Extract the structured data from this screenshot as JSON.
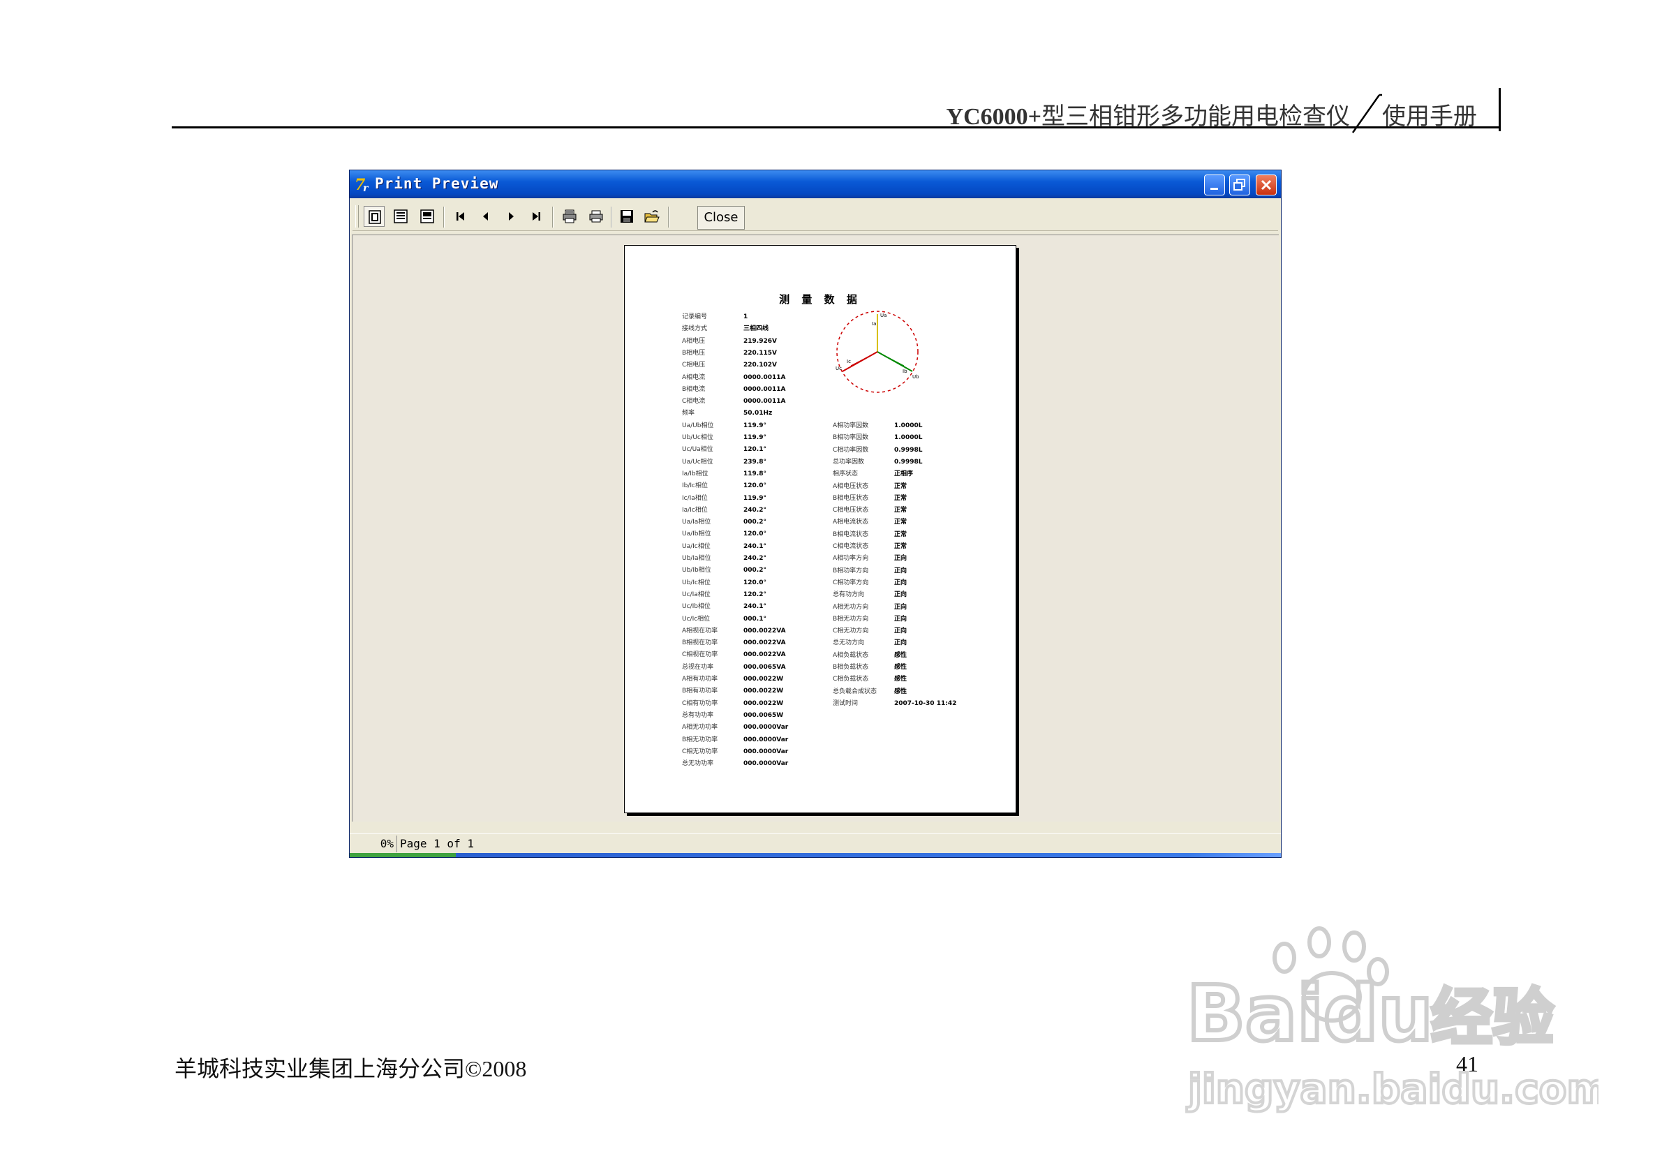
{
  "header": {
    "model_bold": "YC6000+",
    "model_rest": "型三相钳形多功能用电检查仪",
    "manual": "使用手册"
  },
  "window": {
    "title": "Print Preview",
    "toolbar": {
      "icons": [
        "whole-page-icon",
        "page-width-icon",
        "actual-size-icon",
        "first-page-icon",
        "previous-page-icon",
        "next-page-icon",
        "last-page-icon",
        "print-setup-icon",
        "print-icon",
        "save-icon",
        "open-icon"
      ],
      "close_label": "Close"
    },
    "status": {
      "percent": "0%",
      "page": "Page 1 of 1"
    }
  },
  "report": {
    "title": "测 量 数 据",
    "left_rows": [
      {
        "label": "记录编号",
        "value": "1"
      },
      {
        "label": "接线方式",
        "value": "三相四线"
      },
      {
        "label": "A相电压",
        "value": "219.926V"
      },
      {
        "label": "B相电压",
        "value": "220.115V"
      },
      {
        "label": "C相电压",
        "value": "220.102V"
      },
      {
        "label": "A相电流",
        "value": "0000.0011A"
      },
      {
        "label": "B相电流",
        "value": "0000.0011A"
      },
      {
        "label": "C相电流",
        "value": "0000.0011A"
      },
      {
        "label": "频率",
        "value": "50.01Hz"
      },
      {
        "label": "Ua/Ub相位",
        "value": "119.9°"
      },
      {
        "label": "Ub/Uc相位",
        "value": "119.9°"
      },
      {
        "label": "Uc/Ua相位",
        "value": "120.1°"
      },
      {
        "label": "Ua/Uc相位",
        "value": "239.8°"
      },
      {
        "label": "Ia/Ib相位",
        "value": "119.8°"
      },
      {
        "label": "Ib/Ic相位",
        "value": "120.0°"
      },
      {
        "label": "Ic/Ia相位",
        "value": "119.9°"
      },
      {
        "label": "Ia/Ic相位",
        "value": "240.2°"
      },
      {
        "label": "Ua/Ia相位",
        "value": "000.2°"
      },
      {
        "label": "Ua/Ib相位",
        "value": "120.0°"
      },
      {
        "label": "Ua/Ic相位",
        "value": "240.1°"
      },
      {
        "label": "Ub/Ia相位",
        "value": "240.2°"
      },
      {
        "label": "Ub/Ib相位",
        "value": "000.2°"
      },
      {
        "label": "Ub/Ic相位",
        "value": "120.0°"
      },
      {
        "label": "Uc/Ia相位",
        "value": "120.2°"
      },
      {
        "label": "Uc/Ib相位",
        "value": "240.1°"
      },
      {
        "label": "Uc/Ic相位",
        "value": "000.1°"
      },
      {
        "label": "A相视在功率",
        "value": "000.0022VA"
      },
      {
        "label": "B相视在功率",
        "value": "000.0022VA"
      },
      {
        "label": "C相视在功率",
        "value": "000.0022VA"
      },
      {
        "label": "总视在功率",
        "value": "000.0065VA"
      },
      {
        "label": "A相有功功率",
        "value": "000.0022W"
      },
      {
        "label": "B相有功功率",
        "value": "000.0022W"
      },
      {
        "label": "C相有功功率",
        "value": "000.0022W"
      },
      {
        "label": "总有功功率",
        "value": "000.0065W"
      },
      {
        "label": "A相无功功率",
        "value": "000.0000Var"
      },
      {
        "label": "B相无功功率",
        "value": "000.0000Var"
      },
      {
        "label": "C相无功功率",
        "value": "000.0000Var"
      },
      {
        "label": "总无功功率",
        "value": "000.0000Var"
      }
    ],
    "right_rows": [
      {
        "label": "A相功率因数",
        "value": "1.0000L"
      },
      {
        "label": "B相功率因数",
        "value": "1.0000L"
      },
      {
        "label": "C相功率因数",
        "value": "0.9998L"
      },
      {
        "label": "总功率因数",
        "value": "0.9998L"
      },
      {
        "label": "相序状态",
        "value": "正相序"
      },
      {
        "label": "A相电压状态",
        "value": "正常"
      },
      {
        "label": "B相电压状态",
        "value": "正常"
      },
      {
        "label": "C相电压状态",
        "value": "正常"
      },
      {
        "label": "A相电流状态",
        "value": "正常"
      },
      {
        "label": "B相电流状态",
        "value": "正常"
      },
      {
        "label": "C相电流状态",
        "value": "正常"
      },
      {
        "label": "A相功率方向",
        "value": "正向"
      },
      {
        "label": "B相功率方向",
        "value": "正向"
      },
      {
        "label": "C相功率方向",
        "value": "正向"
      },
      {
        "label": "总有功方向",
        "value": "正向"
      },
      {
        "label": "A相无功方向",
        "value": "正向"
      },
      {
        "label": "B相无功方向",
        "value": "正向"
      },
      {
        "label": "C相无功方向",
        "value": "正向"
      },
      {
        "label": "总无功方向",
        "value": "正向"
      },
      {
        "label": "A相负载状态",
        "value": "感性"
      },
      {
        "label": "B相负载状态",
        "value": "感性"
      },
      {
        "label": "C相负载状态",
        "value": "感性"
      },
      {
        "label": "总负载合成状态",
        "value": "感性"
      },
      {
        "label": "测试时间",
        "value": "2007-10-30 11:42"
      }
    ],
    "vector_labels": [
      "Ua",
      "Ia",
      "Ub",
      "Ib",
      "Uc",
      "Ic"
    ]
  },
  "footer": {
    "company": "羊城科技实业集团上海分公司©2008",
    "page_number": "41"
  },
  "watermark": {
    "brand": "Baidu",
    "brand_cn": "经验",
    "url": "jingyan.baidu.com"
  },
  "colors": {
    "titlebar": "#0a5ad6",
    "close_button": "#c83010",
    "window_bg": "#ece9d8",
    "vector_red": "#cc0000",
    "vector_green": "#008800",
    "vector_yellow": "#d8c000"
  }
}
